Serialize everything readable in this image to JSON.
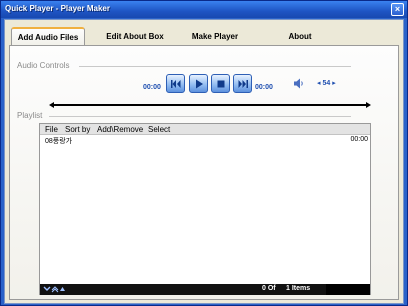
{
  "window": {
    "title": "Quick Player - Player Maker",
    "close_glyph": "×"
  },
  "tabs": [
    {
      "label": "Add Audio Files",
      "active": true
    },
    {
      "label": "Edit About Box",
      "active": false
    },
    {
      "label": "Make Player",
      "active": false
    },
    {
      "label": "About",
      "active": false
    }
  ],
  "audio_controls": {
    "label": "Audio Controls",
    "elapsed": "00:00",
    "total": "00:00",
    "buttons": [
      "previous-icon",
      "play-icon",
      "stop-icon",
      "next-icon"
    ],
    "volume_display": "◂ 54 ▸",
    "speaker_icon": "speaker-icon"
  },
  "playlist": {
    "label": "Playlist",
    "menu": [
      "File",
      "Sort by",
      "Add\\Remove",
      "Select"
    ],
    "items": [
      {
        "name": "08풍랑가",
        "duration": "00:00"
      }
    ],
    "status": {
      "position": "0 Of",
      "count": "1 Items"
    }
  },
  "colors": {
    "titlebar": "#1e55c4",
    "accent_text": "#1f4fb0",
    "button_blue": "#8fbaf0",
    "status_bg": "#111111"
  }
}
